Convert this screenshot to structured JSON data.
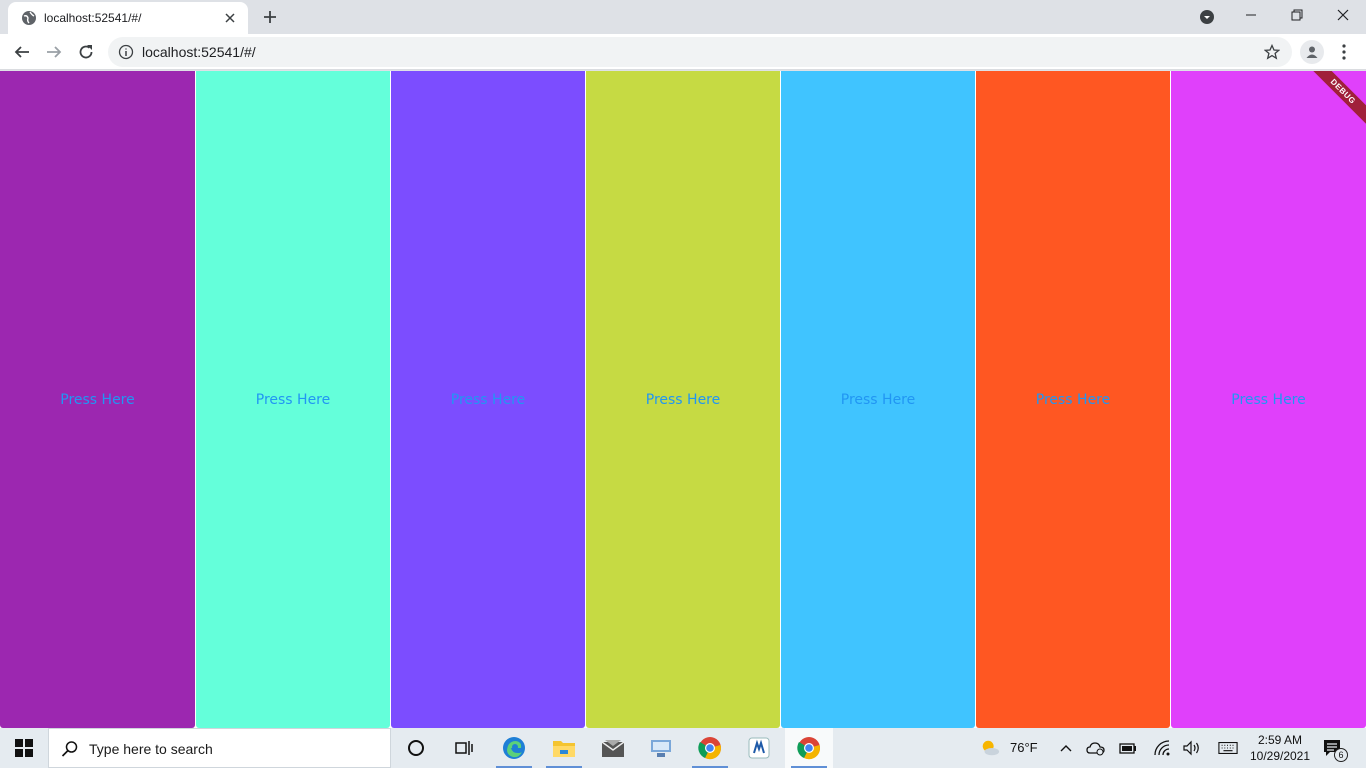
{
  "browser": {
    "tab_title": "localhost:52541/#/",
    "url": "localhost:52541/#/"
  },
  "page": {
    "debug_banner": "DEBUG",
    "panels": [
      {
        "label": "Press Here",
        "color": "#9c27b0"
      },
      {
        "label": "Press Here",
        "color": "#64ffda"
      },
      {
        "label": "Press Here",
        "color": "#7c4dff"
      },
      {
        "label": "Press Here",
        "color": "#c6da43"
      },
      {
        "label": "Press Here",
        "color": "#40c4ff"
      },
      {
        "label": "Press Here",
        "color": "#ff5722"
      },
      {
        "label": "Press Here",
        "color": "#e040fb"
      }
    ],
    "label_color": "#2196f3"
  },
  "taskbar": {
    "search_placeholder": "Type here to search",
    "weather_temp": "76°F",
    "time": "2:59 AM",
    "date": "10/29/2021",
    "notification_count": "6",
    "pinned": [
      "cortana-icon",
      "task-view-icon",
      "edge-icon",
      "file-explorer-icon",
      "mail-icon",
      "network-app-icon",
      "chrome-icon",
      "app-icon",
      "chrome-icon"
    ]
  }
}
